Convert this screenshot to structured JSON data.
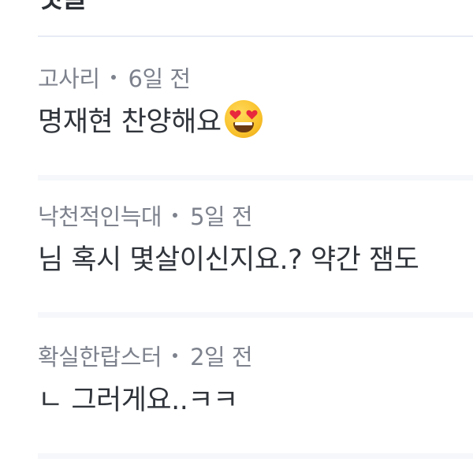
{
  "section": {
    "title": "댓글"
  },
  "comments": [
    {
      "author": "고사리",
      "time": "6일 전",
      "text": "명재현 찬양해요",
      "emoji": "heart-eyes-emoji"
    },
    {
      "author": "낙천적인늑대",
      "time": "5일 전",
      "text": "님 혹시 몇살이신지요.? 약간 잼도"
    },
    {
      "author": "확실한랍스터",
      "time": "2일 전",
      "text": "ㄴ 그러게요..ㅋㅋ"
    }
  ],
  "colors": {
    "meta_text": "#7d828d",
    "body_text": "#30343b",
    "divider": "#f5f7fa",
    "emoji_face": "#f9c22c",
    "emoji_heart": "#e8283c"
  }
}
